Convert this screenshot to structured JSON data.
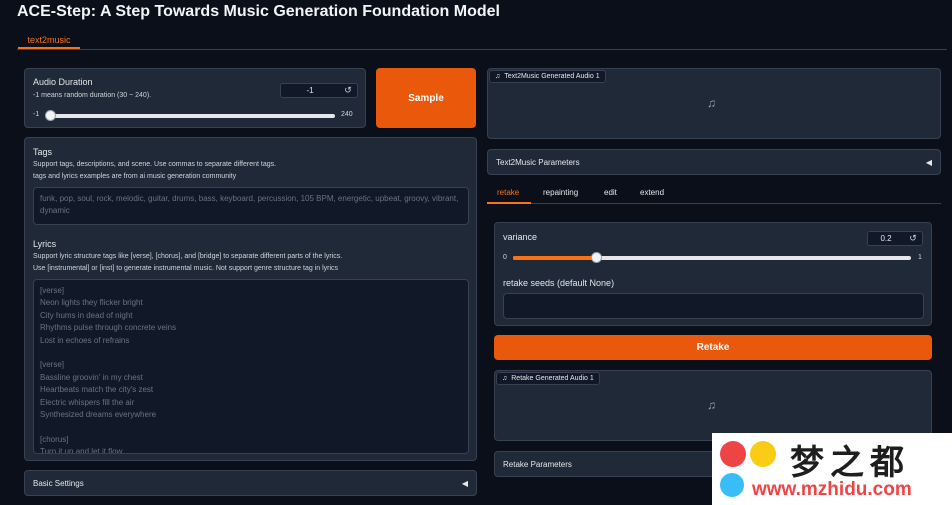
{
  "app": {
    "title": "ACE-Step: A Step Towards Music Generation Foundation Model"
  },
  "main_tab": "text2music",
  "audio_duration": {
    "label": "Audio Duration",
    "info": "-1 means random duration (30 ~ 240).",
    "value": "-1",
    "min": "-1",
    "max": "240",
    "slider_fraction": 0.0
  },
  "sample_button": "Sample",
  "tags": {
    "label": "Tags",
    "info_1": "Support tags, descriptions, and scene. Use commas to separate different tags.",
    "info_2": "tags and lyrics examples are from ai music generation community",
    "placeholder": "funk, pop, soul, rock, melodic, guitar, drums, bass, keyboard, percussion, 105 BPM, energetic, upbeat, groovy, vibrant, dynamic"
  },
  "lyrics": {
    "label": "Lyrics",
    "info_1": "Support lyric structure tags like [verse], [chorus], and [bridge] to separate different parts of the lyrics.",
    "info_2": "Use [instrumental] or [inst] to generate instrumental music. Not support genre structure tag in lyrics",
    "placeholder": "[verse]\nNeon lights they flicker bright\nCity hums in dead of night\nRhythms pulse through concrete veins\nLost in echoes of refrains\n\n[verse]\nBassline groovin' in my chest\nHeartbeats match the city's zest\nElectric whispers fill the air\nSynthesized dreams everywhere\n\n[chorus]\nTurn it up and let it flow"
  },
  "basic_settings": "Basic Settings",
  "generated_audio": {
    "label": "Text2Music Generated Audio 1"
  },
  "params_accordion": "Text2Music Parameters",
  "sub_tabs": [
    "retake",
    "repainting",
    "edit",
    "extend"
  ],
  "variance": {
    "label": "variance",
    "value": "0.2",
    "min": "0",
    "max": "1",
    "slider_fraction": 0.2
  },
  "retake_seeds": {
    "label": "retake seeds (default None)",
    "value": ""
  },
  "retake_button": "Retake",
  "retake_audio": {
    "label": "Retake Generated Audio 1"
  },
  "retake_params": "Retake Parameters",
  "watermark": {
    "text": "梦之都",
    "url": "www.mzhidu.com"
  },
  "colors": {
    "accent": "#ea580c",
    "background": "#0b0f19",
    "panel": "#1f2937"
  }
}
